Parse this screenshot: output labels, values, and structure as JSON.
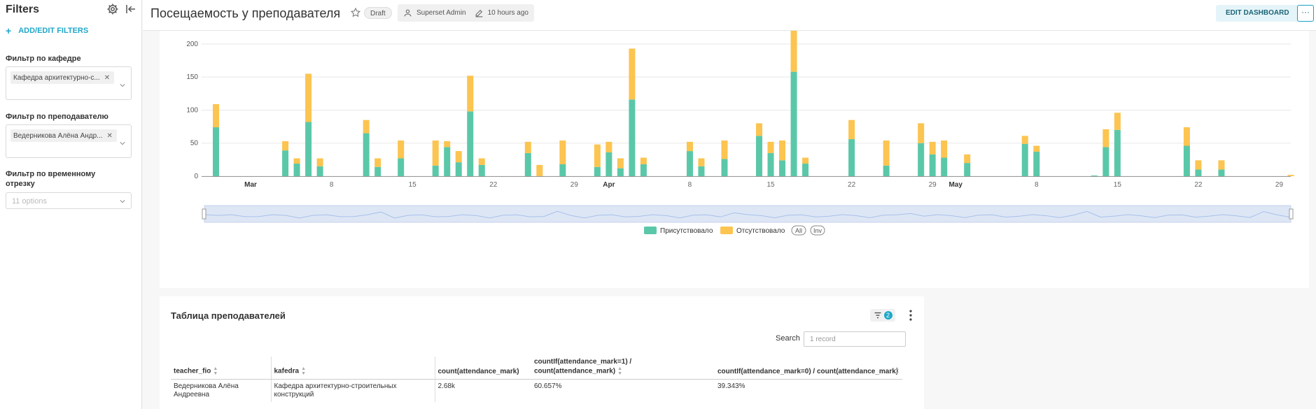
{
  "sidebar": {
    "title": "Filters",
    "add_label": "ADD/EDIT FILTERS",
    "filters": [
      {
        "label": "Фильтр по кафедре",
        "value": "Кафедра архитектурно-с..."
      },
      {
        "label": "Фильтр по преподавателю",
        "value": "Ведерникова Алёна Андр..."
      },
      {
        "label": "Фильтр по временному отрезку",
        "placeholder": "11 options"
      }
    ]
  },
  "header": {
    "title": "Посещаемость у преподавателя",
    "status": "Draft",
    "owner": "Superset Admin",
    "modified": "10 hours ago",
    "edit_label": "EDIT DASHBOARD",
    "more_label": "···"
  },
  "chart_data": {
    "type": "bar",
    "stacked": true,
    "ylim": [
      0,
      220
    ],
    "y_ticks": [
      0,
      50,
      100,
      150,
      200
    ],
    "x_tick_labels": [
      "Mar",
      "8",
      "15",
      "22",
      "29",
      "Apr",
      "8",
      "15",
      "22",
      "29",
      "May",
      "8",
      "15",
      "22",
      "29"
    ],
    "x_tick_bold": [
      true,
      false,
      false,
      false,
      false,
      true,
      false,
      false,
      false,
      false,
      true,
      false,
      false,
      false,
      false
    ],
    "x_tick_days": [
      1,
      8,
      15,
      22,
      29,
      32,
      39,
      46,
      53,
      60,
      62,
      69,
      76,
      83,
      90
    ],
    "day_range": [
      -3,
      91
    ],
    "series": [
      {
        "name": "Присутствовало",
        "color": "#5ac8a8"
      },
      {
        "name": "Отсутствовало",
        "color": "#fcc450"
      }
    ],
    "legend_extra": [
      "All",
      "Inv"
    ],
    "grid": true,
    "legend_position": "bottom",
    "bars": [
      {
        "day": -2,
        "present": 74,
        "absent": 35
      },
      {
        "day": 4,
        "present": 39,
        "absent": 14
      },
      {
        "day": 5,
        "present": 19,
        "absent": 8
      },
      {
        "day": 6,
        "present": 82,
        "absent": 73
      },
      {
        "day": 7,
        "present": 15,
        "absent": 12
      },
      {
        "day": 11,
        "present": 65,
        "absent": 20
      },
      {
        "day": 12,
        "present": 14,
        "absent": 13
      },
      {
        "day": 14,
        "present": 27,
        "absent": 27
      },
      {
        "day": 17,
        "present": 16,
        "absent": 38
      },
      {
        "day": 18,
        "present": 44,
        "absent": 9
      },
      {
        "day": 19,
        "present": 21,
        "absent": 17
      },
      {
        "day": 20,
        "present": 98,
        "absent": 54
      },
      {
        "day": 21,
        "present": 17,
        "absent": 10
      },
      {
        "day": 25,
        "present": 35,
        "absent": 17
      },
      {
        "day": 26,
        "present": 0,
        "absent": 17
      },
      {
        "day": 28,
        "present": 18,
        "absent": 36
      },
      {
        "day": 31,
        "present": 14,
        "absent": 34
      },
      {
        "day": 32,
        "present": 36,
        "absent": 16
      },
      {
        "day": 33,
        "present": 12,
        "absent": 15
      },
      {
        "day": 34,
        "present": 116,
        "absent": 77
      },
      {
        "day": 35,
        "present": 18,
        "absent": 10
      },
      {
        "day": 39,
        "present": 38,
        "absent": 14
      },
      {
        "day": 40,
        "present": 15,
        "absent": 12
      },
      {
        "day": 42,
        "present": 26,
        "absent": 28
      },
      {
        "day": 45,
        "present": 61,
        "absent": 19
      },
      {
        "day": 46,
        "present": 35,
        "absent": 17
      },
      {
        "day": 47,
        "present": 24,
        "absent": 30
      },
      {
        "day": 48,
        "present": 158,
        "absent": 62
      },
      {
        "day": 49,
        "present": 19,
        "absent": 9
      },
      {
        "day": 53,
        "present": 56,
        "absent": 29
      },
      {
        "day": 56,
        "present": 16,
        "absent": 38
      },
      {
        "day": 59,
        "present": 50,
        "absent": 30
      },
      {
        "day": 60,
        "present": 33,
        "absent": 19
      },
      {
        "day": 61,
        "present": 28,
        "absent": 26
      },
      {
        "day": 63,
        "present": 20,
        "absent": 13
      },
      {
        "day": 68,
        "present": 49,
        "absent": 12
      },
      {
        "day": 69,
        "present": 37,
        "absent": 9
      },
      {
        "day": 74,
        "present": 1,
        "absent": 0
      },
      {
        "day": 75,
        "present": 44,
        "absent": 27
      },
      {
        "day": 76,
        "present": 70,
        "absent": 26
      },
      {
        "day": 82,
        "present": 46,
        "absent": 28
      },
      {
        "day": 83,
        "present": 10,
        "absent": 14
      },
      {
        "day": 85,
        "present": 10,
        "absent": 14
      },
      {
        "day": 91,
        "present": 0,
        "absent": 2
      }
    ]
  },
  "table": {
    "title": "Таблица преподавателей",
    "filter_count": "2",
    "search_label": "Search",
    "search_placeholder": "1 record",
    "columns": [
      "teacher_fio",
      "kafedra",
      "count(attendance_mark)",
      "countIf(attendance_mark=1) / count(attendance_mark)",
      "countIf(attendance_mark=0) / count(attendance_mark)"
    ],
    "rows": [
      [
        "Ведерникова Алёна Андреевна",
        "Кафедра архитектурно-строительных конструкций",
        "2.68k",
        "60.657%",
        "39.343%"
      ]
    ]
  }
}
